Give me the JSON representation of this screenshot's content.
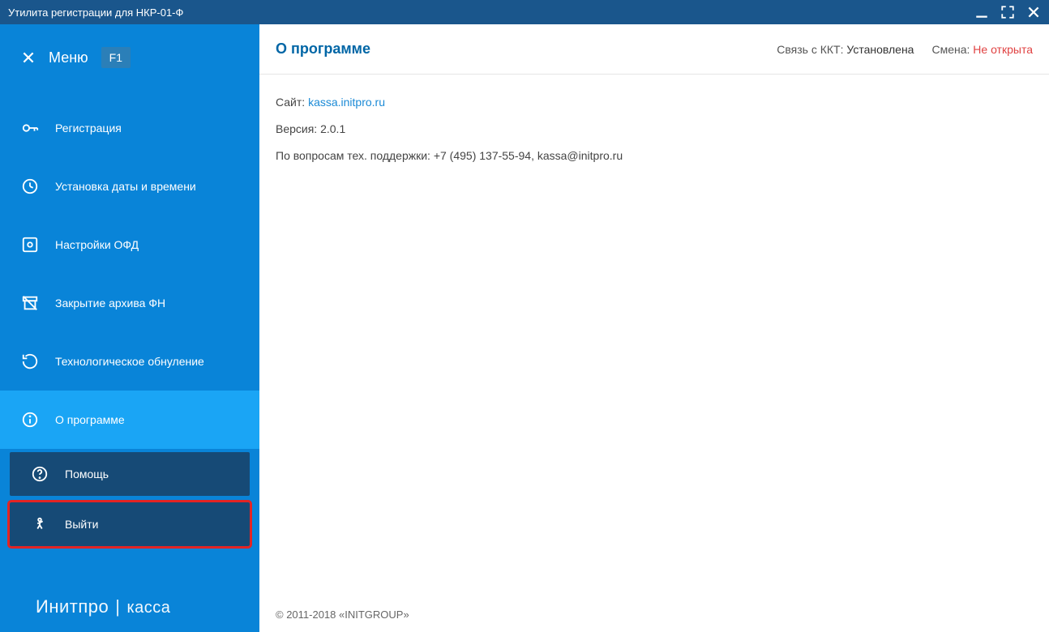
{
  "window": {
    "title": "Утилита регистрации для НКР-01-Ф"
  },
  "sidebar": {
    "menu_label": "Меню",
    "menu_badge": "F1",
    "items": [
      {
        "label": "Регистрация"
      },
      {
        "label": "Установка даты и времени"
      },
      {
        "label": "Настройки ОФД"
      },
      {
        "label": "Закрытие архива ФН"
      },
      {
        "label": "Технологическое обнуление"
      },
      {
        "label": "О программе"
      }
    ],
    "help_label": "Помощь",
    "exit_label": "Выйти",
    "brand_left": "Инитпро",
    "brand_right": "касса"
  },
  "main": {
    "title": "О программе",
    "status_kkt_label": "Связь с ККТ:",
    "status_kkt_value": "Установлена",
    "status_shift_label": "Смена:",
    "status_shift_value": "Не открыта",
    "site_label": "Сайт:",
    "site_link": "kassa.initpro.ru",
    "version_label": "Версия:",
    "version_value": "2.0.1",
    "support_text": "По вопросам тех. поддержки: +7 (495) 137-55-94, kassa@initpro.ru",
    "copyright": "© 2011-2018 «INITGROUP»"
  }
}
